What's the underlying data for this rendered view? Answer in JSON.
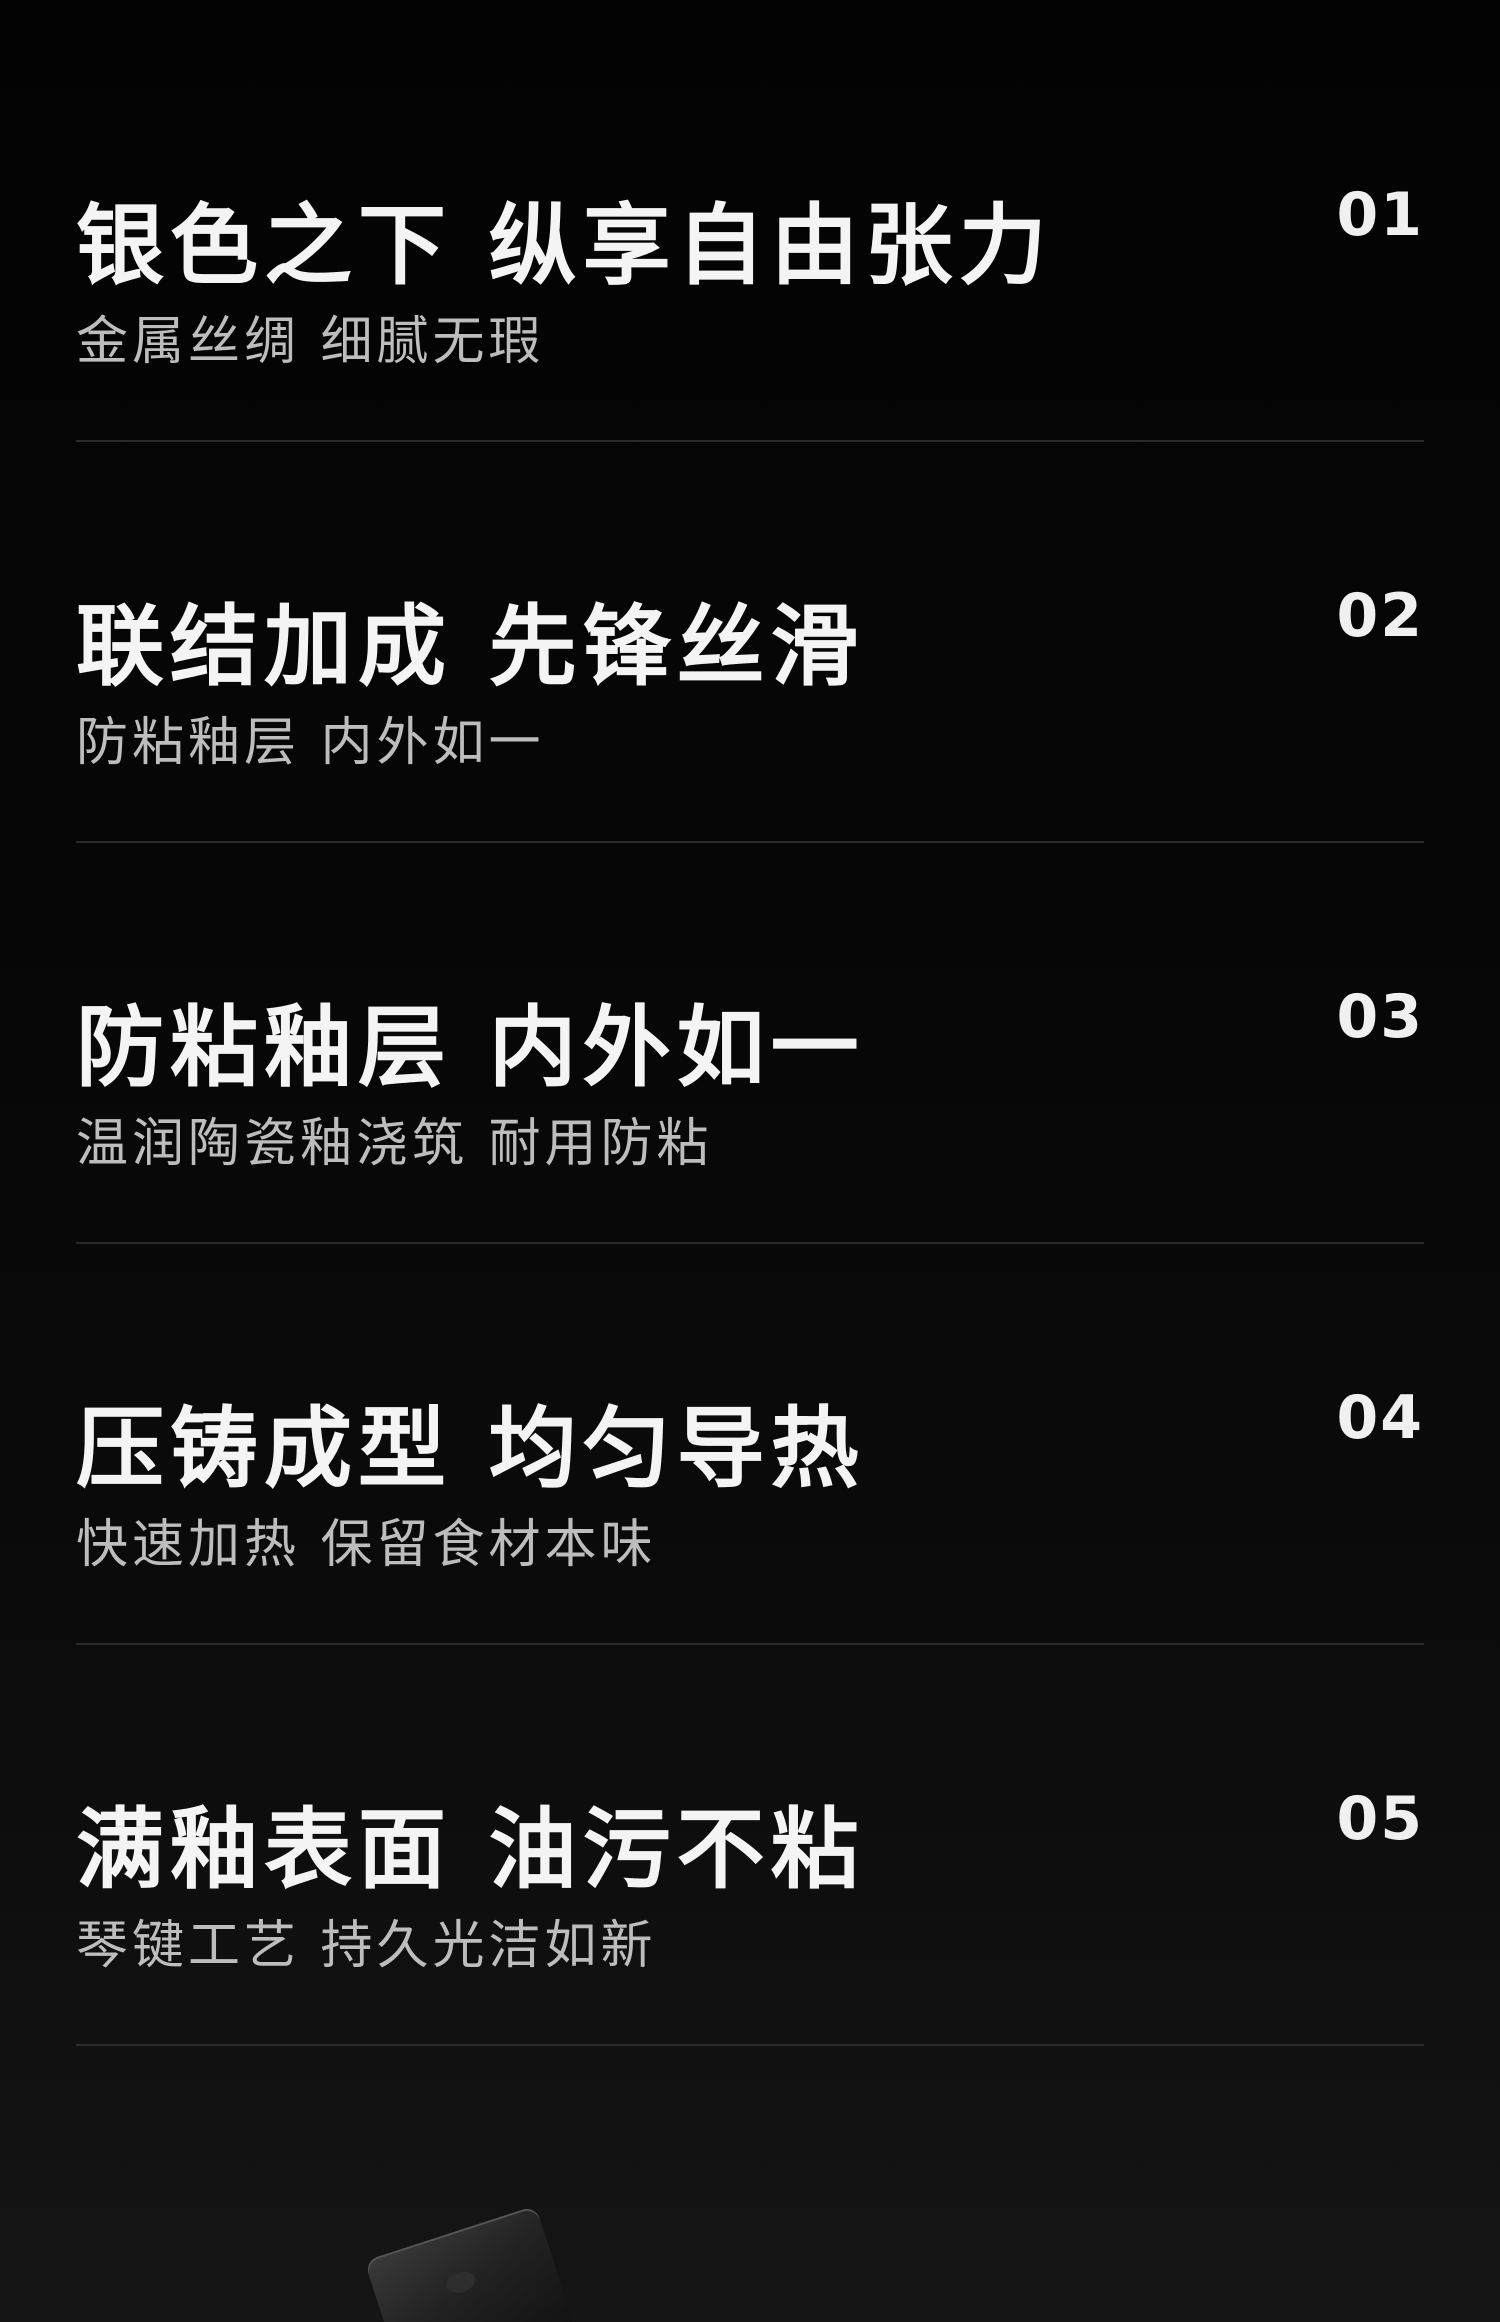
{
  "features": [
    {
      "number": "01",
      "title": "银色之下 纵享自由张力",
      "subtitle": "金属丝绸 细腻无瑕"
    },
    {
      "number": "02",
      "title": "联结加成 先锋丝滑",
      "subtitle": "防粘釉层 内外如一"
    },
    {
      "number": "03",
      "title": "防粘釉层 内外如一",
      "subtitle": "温润陶瓷釉浇筑 耐用防粘"
    },
    {
      "number": "04",
      "title": "压铸成型 均匀导热",
      "subtitle": "快速加热 保留食材本味"
    },
    {
      "number": "05",
      "title": "满釉表面 油污不粘",
      "subtitle": "琴键工艺 持久光洁如新"
    }
  ]
}
